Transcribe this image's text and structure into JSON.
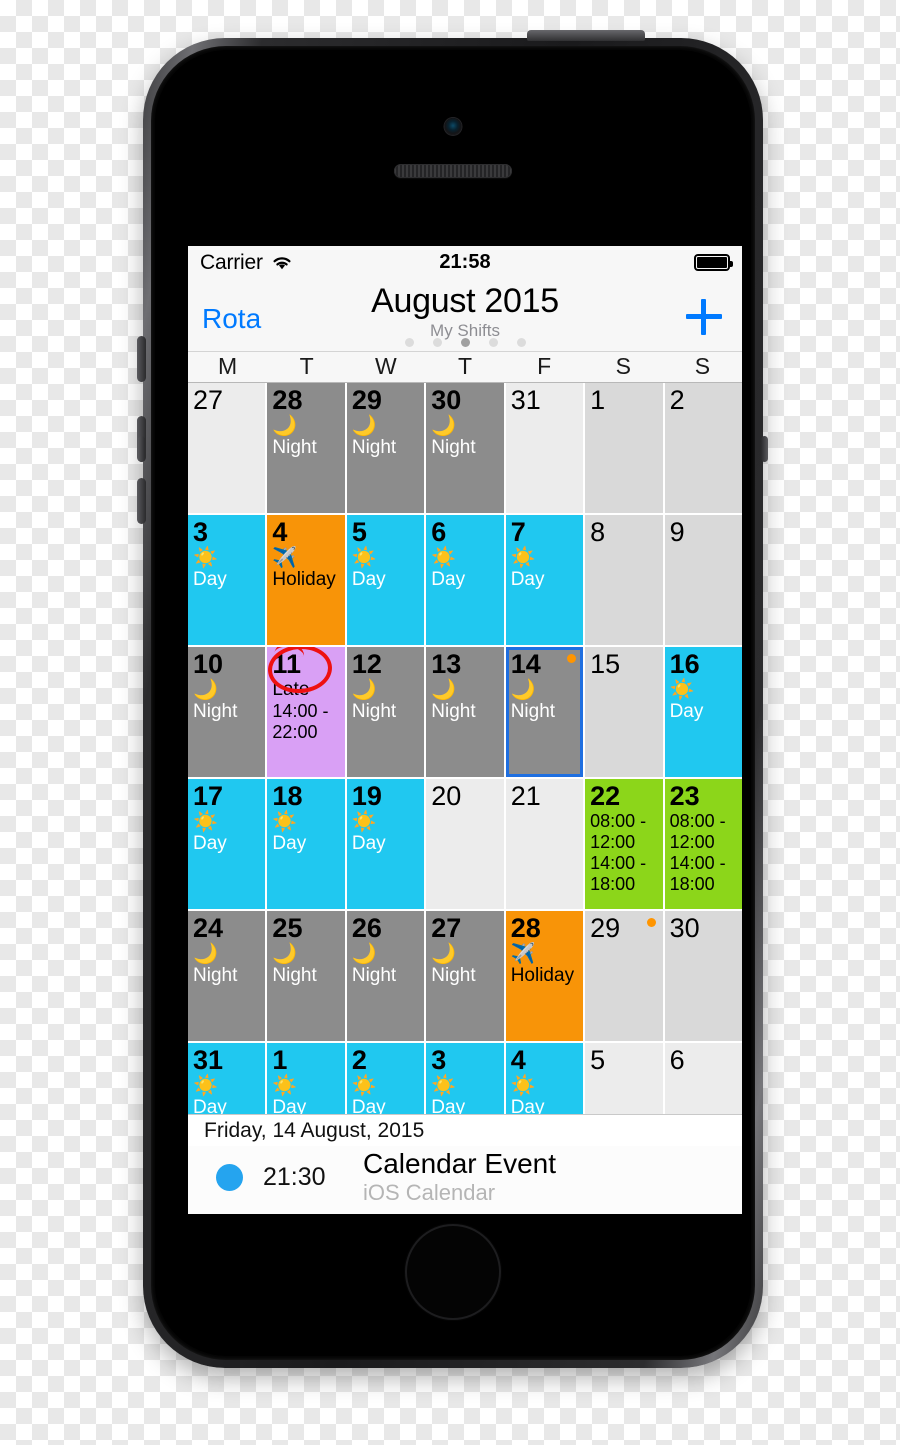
{
  "status_bar": {
    "carrier": "Carrier",
    "wifi_icon": "wifi-icon",
    "time": "21:58",
    "battery_icon": "battery-full-icon"
  },
  "nav": {
    "back_label": "Rota",
    "title": "August 2015",
    "subtitle": "My Shifts",
    "add_icon": "plus-icon",
    "page_dots": 5,
    "active_dot": 3
  },
  "weekday_headers": [
    "M",
    "T",
    "W",
    "T",
    "F",
    "S",
    "S"
  ],
  "colors": {
    "day": "#20c8f0",
    "night": "#8c8c8c",
    "holiday": "#f89408",
    "late": "#d9a0f5",
    "split": "#8cd61a",
    "weekday_empty": "#ececec",
    "weekend_empty": "#d9d9d9",
    "selection": "#1f6fe0",
    "event_dot": "#ff9500",
    "accent": "#007aff",
    "annotation": "#ee1111"
  },
  "cells": [
    {
      "day": "27",
      "type": "empty",
      "icon": "",
      "label": "",
      "times": ""
    },
    {
      "day": "28",
      "type": "night",
      "icon": "🌙",
      "label": "Night",
      "times": ""
    },
    {
      "day": "29",
      "type": "night",
      "icon": "🌙",
      "label": "Night",
      "times": ""
    },
    {
      "day": "30",
      "type": "night",
      "icon": "🌙",
      "label": "Night",
      "times": ""
    },
    {
      "day": "31",
      "type": "empty",
      "icon": "",
      "label": "",
      "times": ""
    },
    {
      "day": "1",
      "type": "weekend",
      "icon": "",
      "label": "",
      "times": ""
    },
    {
      "day": "2",
      "type": "weekend",
      "icon": "",
      "label": "",
      "times": ""
    },
    {
      "day": "3",
      "type": "day",
      "icon": "☀️",
      "label": "Day",
      "times": ""
    },
    {
      "day": "4",
      "type": "holiday",
      "icon": "✈️",
      "label": "Holiday",
      "times": ""
    },
    {
      "day": "5",
      "type": "day",
      "icon": "☀️",
      "label": "Day",
      "times": ""
    },
    {
      "day": "6",
      "type": "day",
      "icon": "☀️",
      "label": "Day",
      "times": ""
    },
    {
      "day": "7",
      "type": "day",
      "icon": "☀️",
      "label": "Day",
      "times": ""
    },
    {
      "day": "8",
      "type": "weekend",
      "icon": "",
      "label": "",
      "times": ""
    },
    {
      "day": "9",
      "type": "weekend",
      "icon": "",
      "label": "",
      "times": ""
    },
    {
      "day": "10",
      "type": "night",
      "icon": "🌙",
      "label": "Night",
      "times": ""
    },
    {
      "day": "11",
      "type": "late",
      "icon": "",
      "label": "Late",
      "times": "14:00 -\n22:00",
      "annotated": true
    },
    {
      "day": "12",
      "type": "night",
      "icon": "🌙",
      "label": "Night",
      "times": ""
    },
    {
      "day": "13",
      "type": "night",
      "icon": "🌙",
      "label": "Night",
      "times": ""
    },
    {
      "day": "14",
      "type": "night",
      "icon": "🌙",
      "label": "Night",
      "times": "",
      "selected": true,
      "event_dot": true
    },
    {
      "day": "15",
      "type": "weekend",
      "icon": "",
      "label": "",
      "times": ""
    },
    {
      "day": "16",
      "type": "day",
      "icon": "☀️",
      "label": "Day",
      "times": ""
    },
    {
      "day": "17",
      "type": "day",
      "icon": "☀️",
      "label": "Day",
      "times": ""
    },
    {
      "day": "18",
      "type": "day",
      "icon": "☀️",
      "label": "Day",
      "times": ""
    },
    {
      "day": "19",
      "type": "day",
      "icon": "☀️",
      "label": "Day",
      "times": ""
    },
    {
      "day": "20",
      "type": "empty",
      "icon": "",
      "label": "",
      "times": ""
    },
    {
      "day": "21",
      "type": "empty",
      "icon": "",
      "label": "",
      "times": ""
    },
    {
      "day": "22",
      "type": "split",
      "icon": "",
      "label": "",
      "times": "08:00 -\n12:00\n14:00 -\n18:00"
    },
    {
      "day": "23",
      "type": "split",
      "icon": "",
      "label": "",
      "times": "08:00 -\n12:00\n14:00 -\n18:00"
    },
    {
      "day": "24",
      "type": "night",
      "icon": "🌙",
      "label": "Night",
      "times": ""
    },
    {
      "day": "25",
      "type": "night",
      "icon": "🌙",
      "label": "Night",
      "times": ""
    },
    {
      "day": "26",
      "type": "night",
      "icon": "🌙",
      "label": "Night",
      "times": ""
    },
    {
      "day": "27",
      "type": "night",
      "icon": "🌙",
      "label": "Night",
      "times": ""
    },
    {
      "day": "28",
      "type": "holiday",
      "icon": "✈️",
      "label": "Holiday",
      "times": ""
    },
    {
      "day": "29",
      "type": "weekend",
      "icon": "",
      "label": "",
      "times": "",
      "event_dot": true
    },
    {
      "day": "30",
      "type": "weekend",
      "icon": "",
      "label": "",
      "times": ""
    },
    {
      "day": "31",
      "type": "day",
      "icon": "☀️",
      "label": "Day",
      "times": ""
    },
    {
      "day": "1",
      "type": "day",
      "icon": "☀️",
      "label": "Day",
      "times": ""
    },
    {
      "day": "2",
      "type": "day",
      "icon": "☀️",
      "label": "Day",
      "times": ""
    },
    {
      "day": "3",
      "type": "day",
      "icon": "☀️",
      "label": "Day",
      "times": ""
    },
    {
      "day": "4",
      "type": "day",
      "icon": "☀️",
      "label": "Day",
      "times": ""
    },
    {
      "day": "5",
      "type": "empty",
      "icon": "",
      "label": "",
      "times": ""
    },
    {
      "day": "6",
      "type": "empty",
      "icon": "",
      "label": "",
      "times": ""
    }
  ],
  "event_panel": {
    "date": "Friday, 14 August, 2015",
    "events": [
      {
        "time": "21:30",
        "title": "Calendar Event",
        "calendar": "iOS Calendar"
      }
    ]
  }
}
